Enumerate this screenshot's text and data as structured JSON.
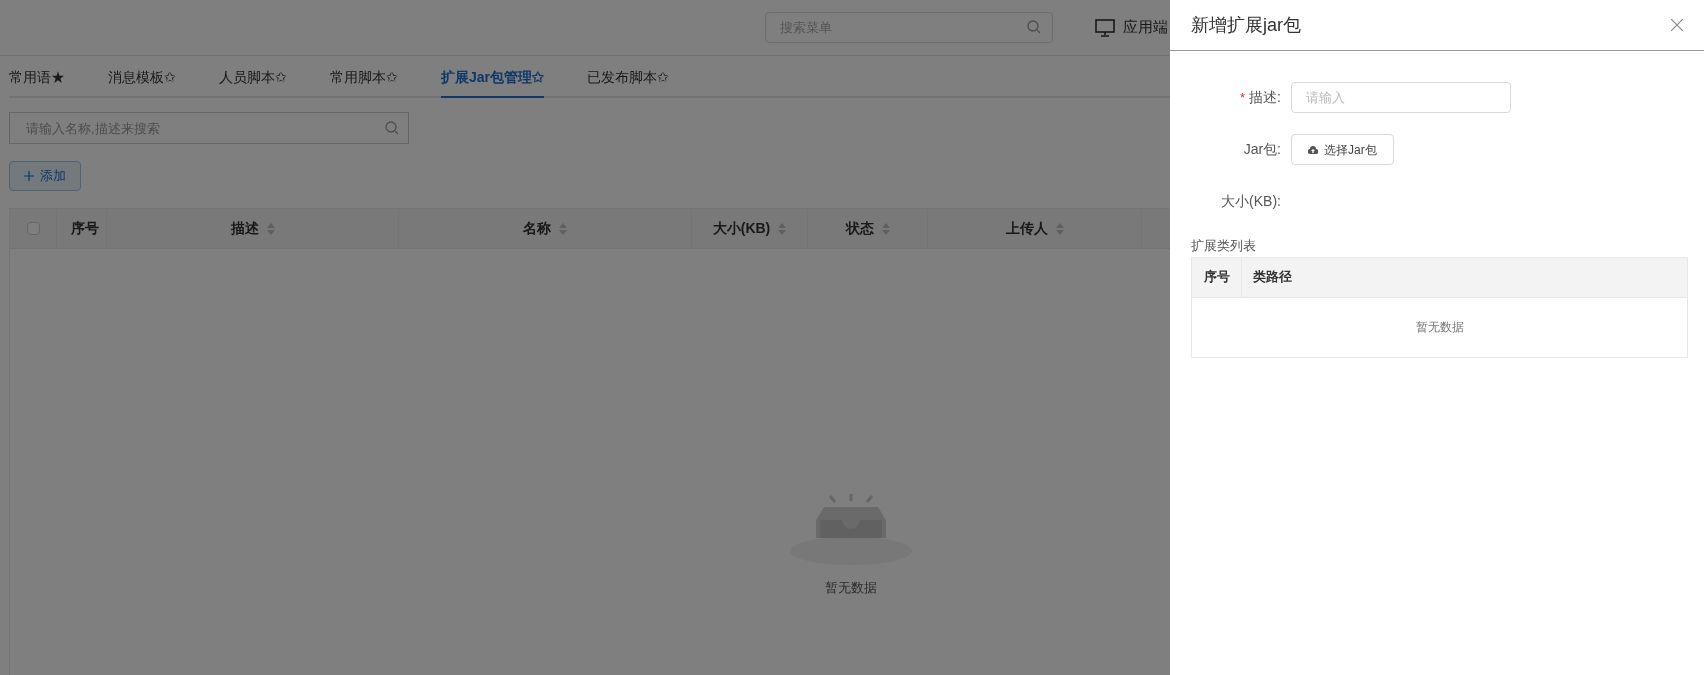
{
  "header": {
    "menu_search": {
      "placeholder": "搜索菜单"
    },
    "client_label": "应用端"
  },
  "tabs": [
    {
      "label": "常用语★",
      "selected": false
    },
    {
      "label": "消息模板✩",
      "selected": false
    },
    {
      "label": "人员脚本✩",
      "selected": false
    },
    {
      "label": "常用脚本✩",
      "selected": false
    },
    {
      "label": "扩展Jar包管理✩",
      "selected": true
    },
    {
      "label": "已发布脚本✩",
      "selected": false
    }
  ],
  "search": {
    "placeholder": "请输入名称,描述来搜索"
  },
  "add_button": "添加",
  "table": {
    "select_all": {
      "checked": false
    },
    "columns": [
      {
        "label": "序号",
        "sortable": false
      },
      {
        "label": "描述",
        "sortable": true
      },
      {
        "label": "名称",
        "sortable": true
      },
      {
        "label": "大小(KB)",
        "sortable": true
      },
      {
        "label": "状态",
        "sortable": true
      },
      {
        "label": "上传人",
        "sortable": true
      }
    ],
    "empty_text": "暂无数据"
  },
  "drawer": {
    "title": "新增扩展jar包",
    "fields": [
      {
        "kind": "input",
        "required_mark": "*",
        "label": "描述:",
        "placeholder": "请输入"
      },
      {
        "kind": "upload",
        "label": "Jar包:",
        "button": "选择Jar包"
      },
      {
        "kind": "value",
        "label": "大小(KB):"
      }
    ],
    "class_list": {
      "title": "扩展类列表",
      "columns": [
        "序号",
        "类路径"
      ],
      "empty_text": "暂无数据"
    }
  }
}
